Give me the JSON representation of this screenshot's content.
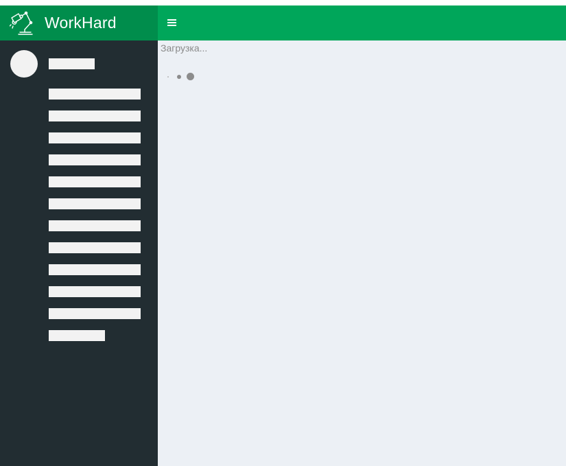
{
  "brand": {
    "title": "WorkHard",
    "icon": "desk-lamp-icon"
  },
  "header": {
    "menu_toggle_icon": "hamburger-menu-icon"
  },
  "content": {
    "loading_text": "Загрузка..."
  },
  "colors": {
    "brand_bg": "#008d4c",
    "header_bg": "#00a65a",
    "sidebar_bg": "#222d32",
    "content_bg": "#ecf0f5",
    "placeholder": "#f2f2f2"
  }
}
